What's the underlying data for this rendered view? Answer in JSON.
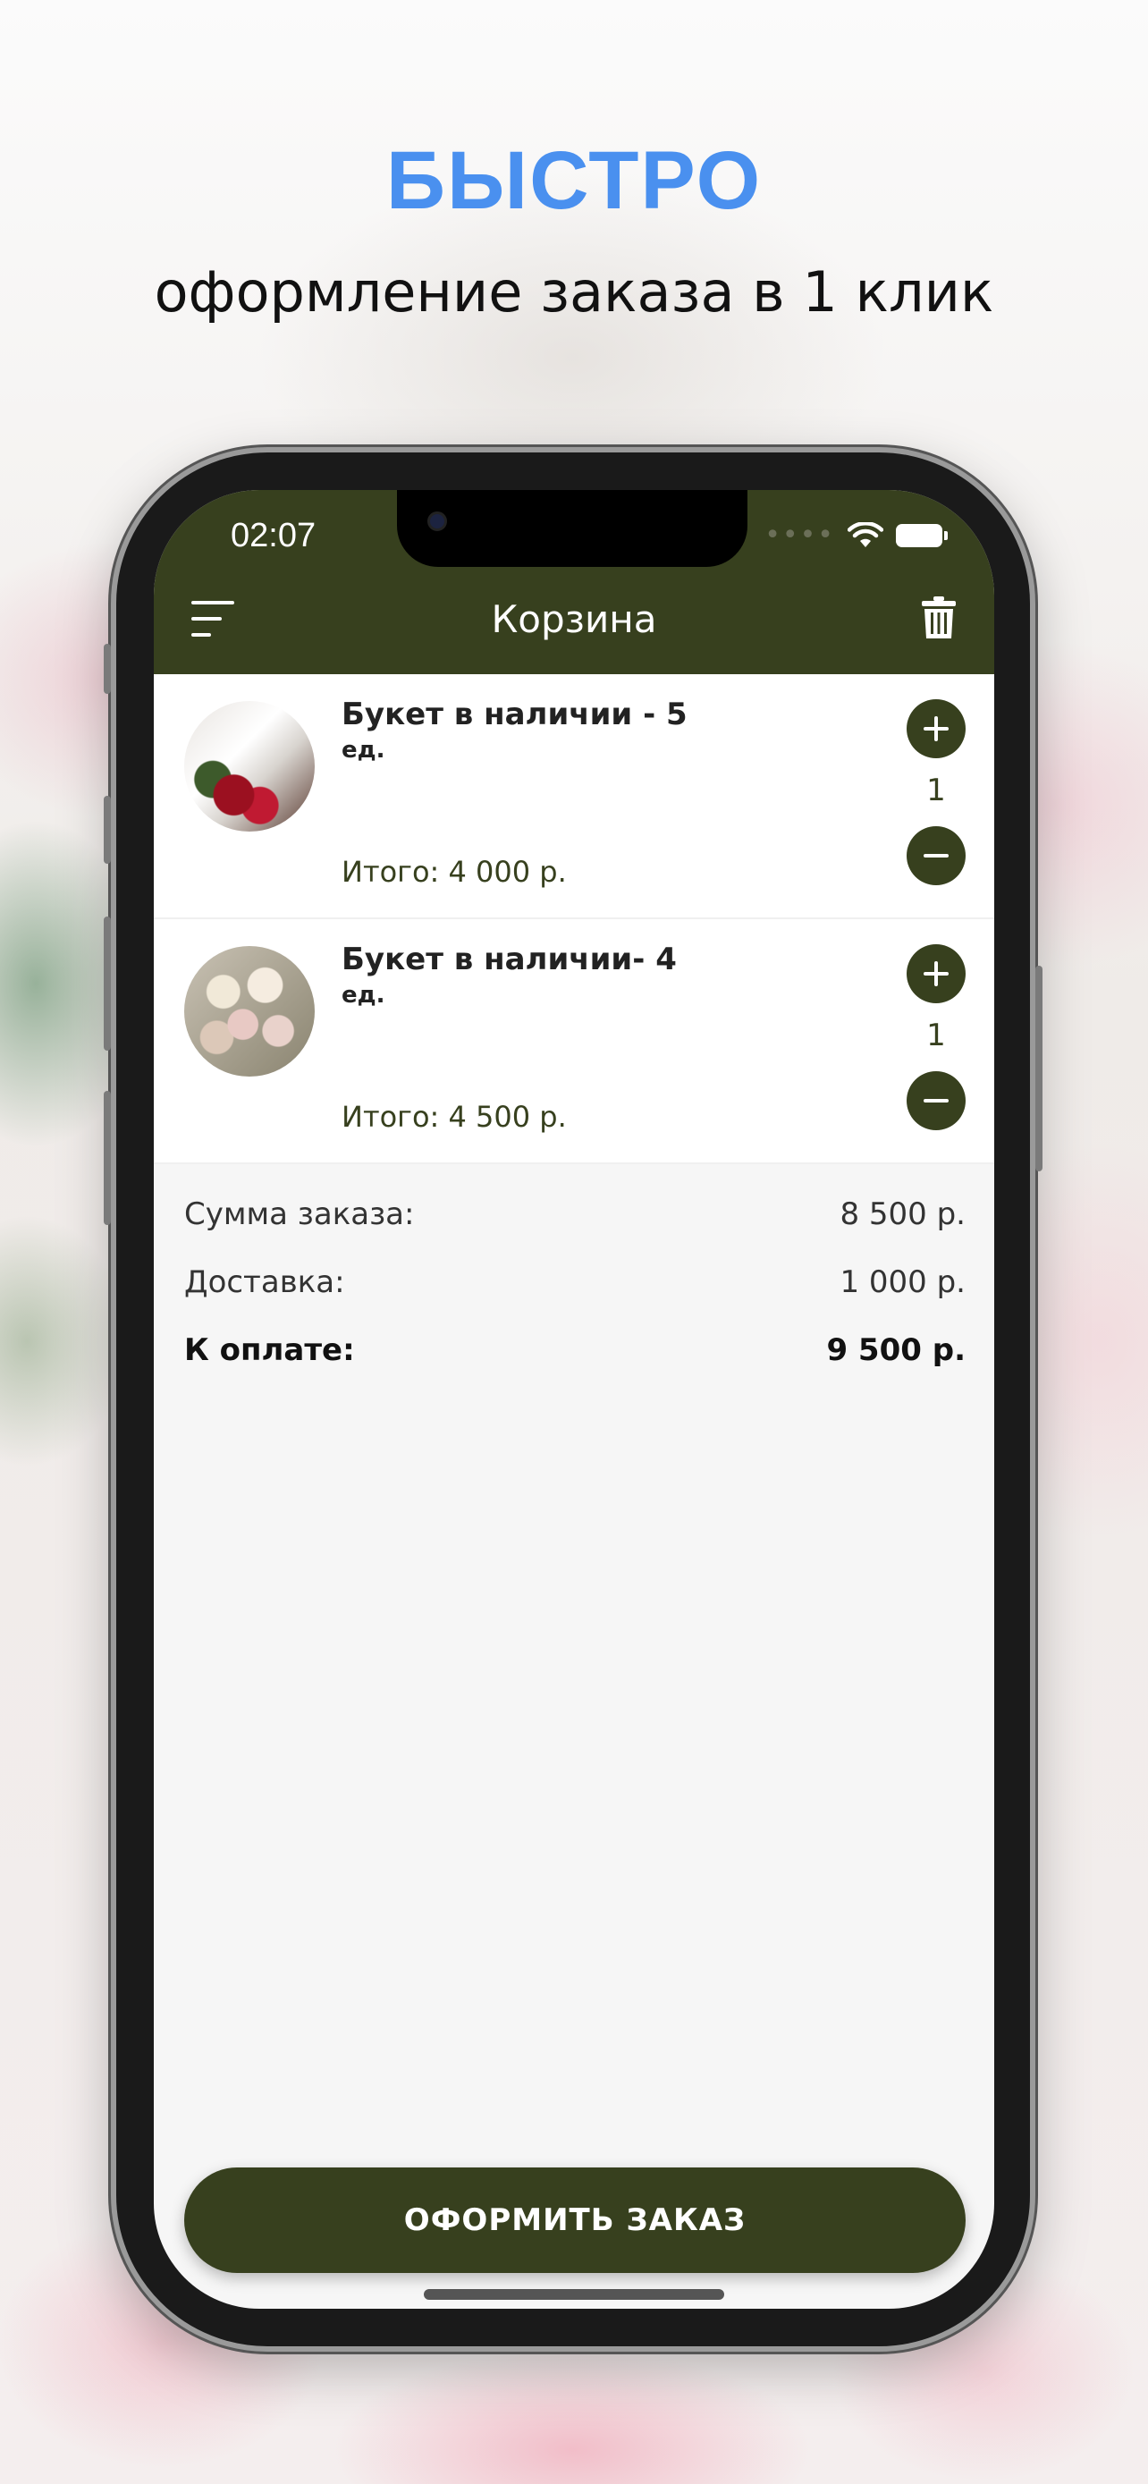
{
  "promo": {
    "headline": "БЫСТРО",
    "subline": "оформление заказа в 1 клик"
  },
  "status_bar": {
    "time": "02:07",
    "icons": [
      "signal-icon",
      "wifi-icon",
      "battery-icon"
    ]
  },
  "header": {
    "title": "Корзина",
    "menu_icon": "menu-icon",
    "trash_icon": "trash-icon"
  },
  "cart": {
    "items": [
      {
        "name": "Букет в наличии - 5",
        "unit": "ед.",
        "quantity": "1",
        "total": "Итого: 4 000 р."
      },
      {
        "name": "Букет в наличии- 4",
        "unit": "ед.",
        "quantity": "1",
        "total": "Итого: 4 500 р."
      }
    ]
  },
  "summary": {
    "subtotal_label": "Сумма заказа:",
    "subtotal_value": "8 500 р.",
    "delivery_label": "Доставка:",
    "delivery_value": "1 000 р.",
    "total_label": "К оплате:",
    "total_value": "9 500 р."
  },
  "checkout": {
    "label": "ОФОРМИТЬ ЗАКАЗ"
  },
  "colors": {
    "accent": "#37401e",
    "headline": "#4a90ef",
    "screen_bg": "#f6f6f6"
  }
}
